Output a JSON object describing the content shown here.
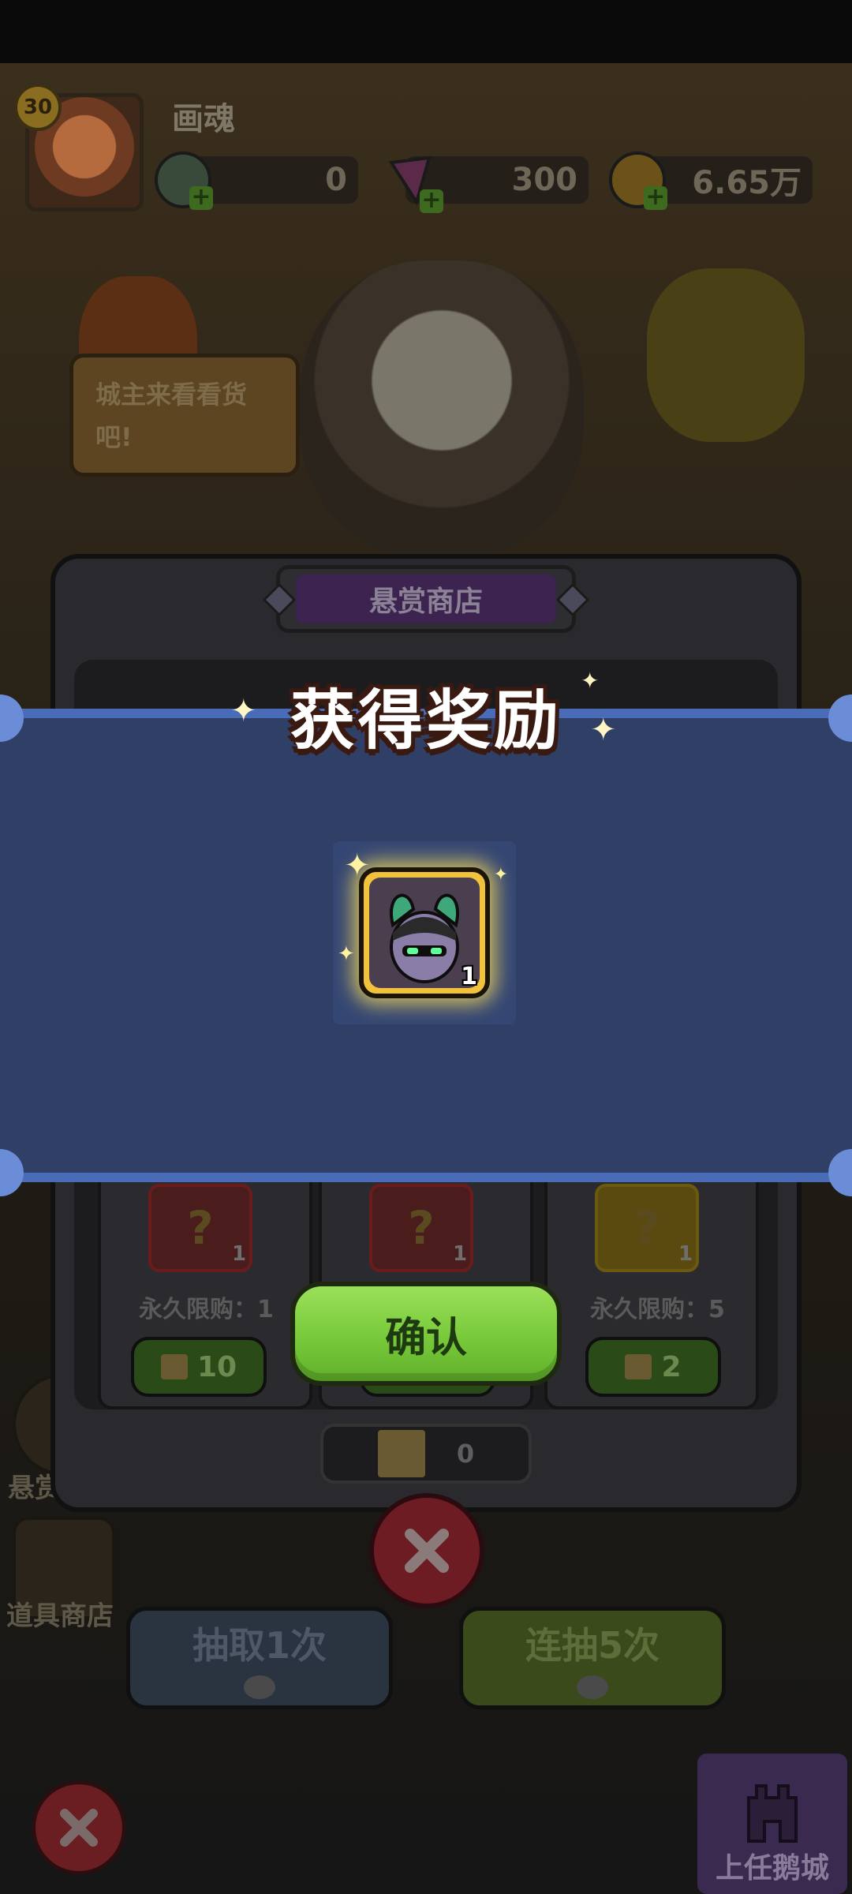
{
  "header": {
    "level": "30",
    "player_name": "画魂",
    "currencies": [
      {
        "icon": "green-orb-icon",
        "value": "0"
      },
      {
        "icon": "pink-gem-icon",
        "value": "300"
      },
      {
        "icon": "gold-coin-icon",
        "value": "6.65万"
      }
    ]
  },
  "shop_scene": {
    "merchant_speech": "城主来看看货吧!"
  },
  "side_menu": {
    "bounty_label": "悬赏",
    "item_shop_label": "道具商店"
  },
  "shop_dialog": {
    "title": "悬赏商店",
    "items": [
      {
        "qty": "1",
        "limit": "永久限购：1",
        "price": "10",
        "frame_color": "#6a1c1c"
      },
      {
        "qty": "1",
        "limit": "",
        "price": "",
        "frame_color": "#6a1c1c"
      },
      {
        "qty": "1",
        "limit": "永久限购：5",
        "price": "2",
        "frame_color": "#6a5a10"
      }
    ],
    "balance": "0"
  },
  "draw_buttons": {
    "single": "抽取1次",
    "five": "连抽5次"
  },
  "appoint_button": "上任鹅城",
  "reward_popup": {
    "title": "获得奖励",
    "item_qty": "1",
    "confirm_label": "确认"
  },
  "colors": {
    "band": "#2f3f66",
    "band_border": "#4a6bb8",
    "confirm_green": "#78c93a",
    "reward_gold": "#f2c33a"
  }
}
